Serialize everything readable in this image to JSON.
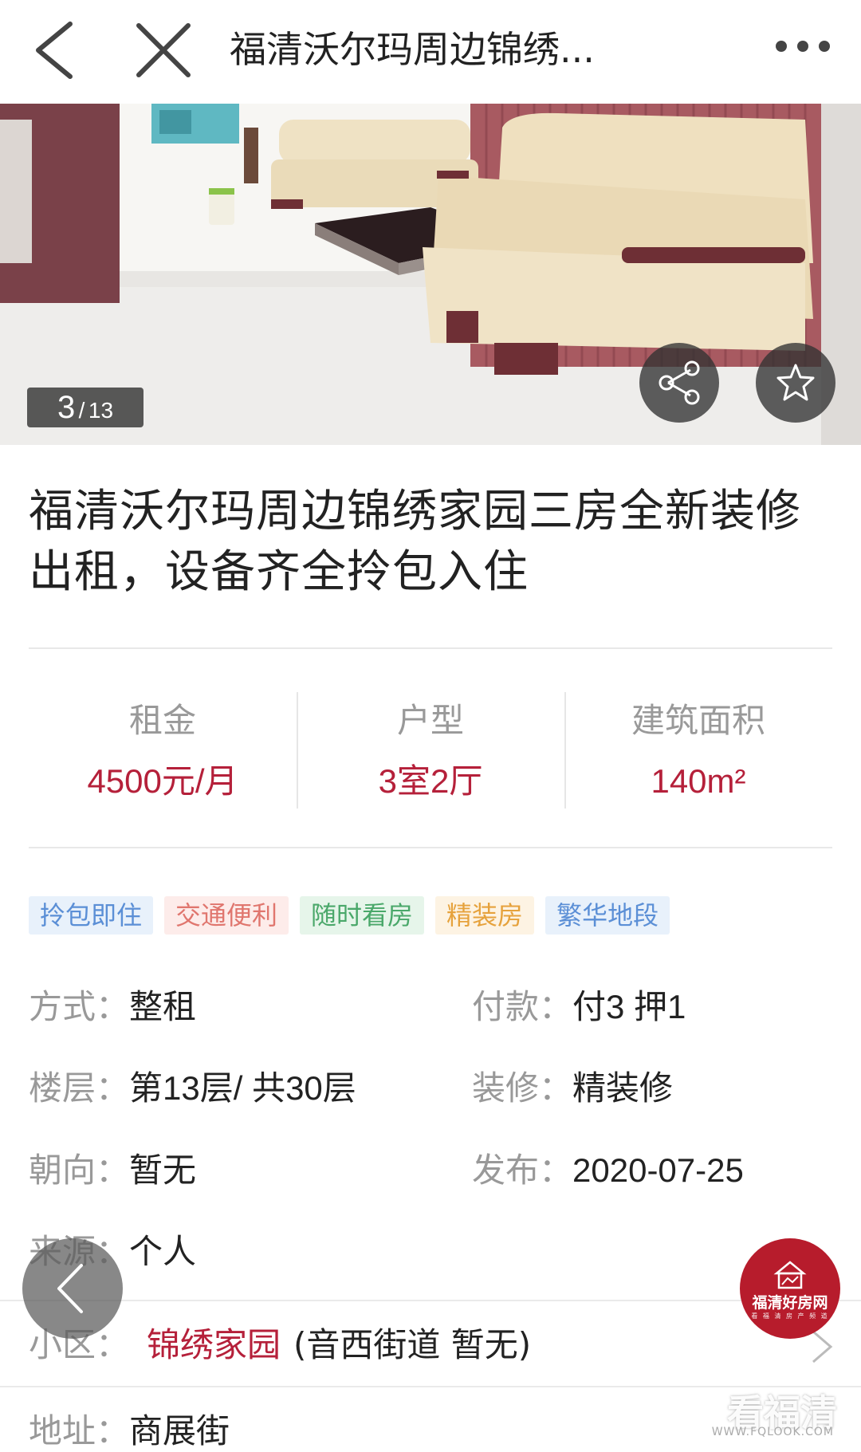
{
  "header": {
    "title": "福清沃尔玛周边锦绣...",
    "back_icon": "chevron-left-icon",
    "close_icon": "close-icon",
    "more_icon": "more-dots-icon"
  },
  "gallery": {
    "current": "3",
    "separator": "/",
    "total": "13",
    "share_icon": "share-icon",
    "favorite_icon": "star-icon"
  },
  "listing": {
    "headline": "福清沃尔玛周边锦绣家园三房全新装修出租，设备齐全拎包入住"
  },
  "stats": [
    {
      "label": "租金",
      "value": "4500元/月"
    },
    {
      "label": "户型",
      "value": "3室2厅"
    },
    {
      "label": "建筑面积",
      "value": "140m²"
    }
  ],
  "tags": [
    {
      "text": "拎包即住",
      "color": "#5b8fd6",
      "bg": "#e8f1fb"
    },
    {
      "text": "交通便利",
      "color": "#e0766e",
      "bg": "#fdecea"
    },
    {
      "text": "随时看房",
      "color": "#4aa86a",
      "bg": "#e6f5ea"
    },
    {
      "text": "精装房",
      "color": "#e6a23c",
      "bg": "#fdf3e3"
    },
    {
      "text": "繁华地段",
      "color": "#5b8fd6",
      "bg": "#e8f1fb"
    }
  ],
  "details": {
    "mode_label": "方式：",
    "mode_value": "整租",
    "payment_label": "付款：",
    "payment_value": "付3 押1",
    "floor_label": "楼层：",
    "floor_value": "第13层/ 共30层",
    "decor_label": "装修：",
    "decor_value": "精装修",
    "orientation_label": "朝向：",
    "orientation_value": "暂无",
    "publish_label": "发布：",
    "publish_value": "2020-07-25",
    "source_label": "来源：",
    "source_value": "个人"
  },
  "community": {
    "label": "小区：",
    "link": "锦绣家园",
    "rest": "(音西街道 暂无)"
  },
  "address": {
    "label": "地址：",
    "value": "商展街"
  },
  "badge": {
    "text": "福清好房网",
    "sub": "看 福 清 房 产 频 道"
  },
  "watermark": {
    "text": "看福清",
    "url": "WWW.FQLOOK.COM"
  },
  "colors": {
    "accent": "#b5203a",
    "label_gray": "#999999"
  }
}
